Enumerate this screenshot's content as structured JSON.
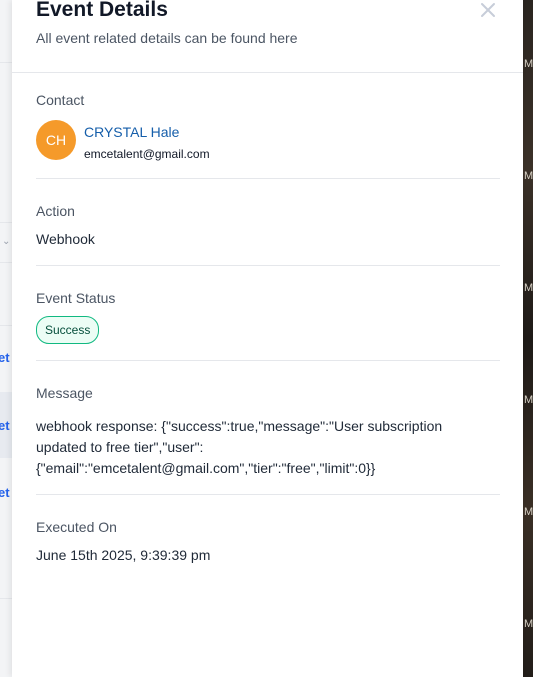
{
  "drawer": {
    "title": "Event Details",
    "subtitle": "All event related details can be found here",
    "close_icon": "close-icon"
  },
  "contact": {
    "label": "Contact",
    "initials": "CH",
    "name": "CRYSTAL Hale",
    "email": "emcetalent@gmail.com",
    "avatar_color": "#f59a2a"
  },
  "action": {
    "label": "Action",
    "value": "Webhook"
  },
  "event_status": {
    "label": "Event Status",
    "value": "Success",
    "color": "#10b981"
  },
  "message": {
    "label": "Message",
    "value": "webhook response: {\"success\":true,\"message\":\"User subscription updated to free tier\",\"user\":{\"email\":\"emcetalent@gmail.com\",\"tier\":\"free\",\"limit\":0}}"
  },
  "executed_on": {
    "label": "Executed On",
    "value": "June 15th 2025, 9:39:39 pm"
  },
  "background": {
    "left_fragments": [
      "et",
      "et",
      "et"
    ],
    "right_fragments": [
      "M",
      "M",
      "M",
      "M",
      "M",
      "M"
    ]
  }
}
